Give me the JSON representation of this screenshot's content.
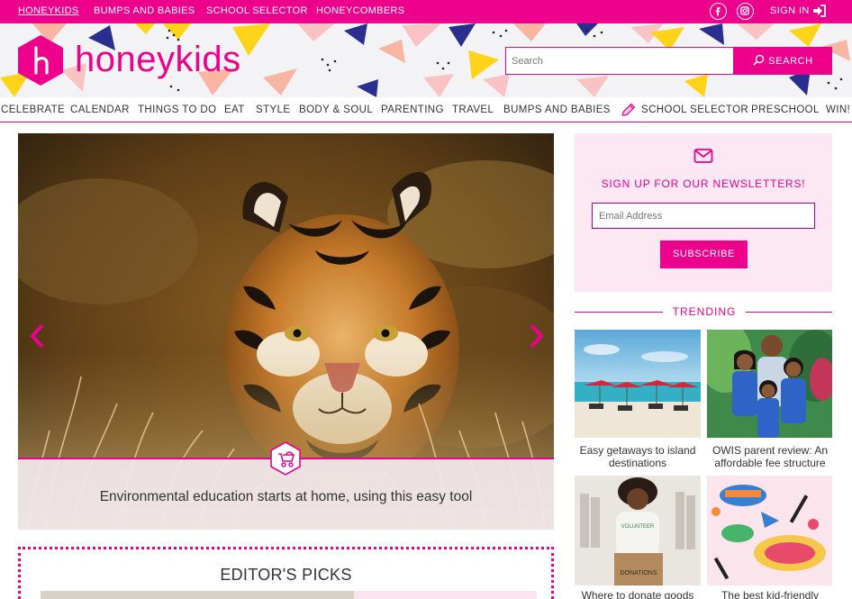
{
  "topbar": {
    "links": [
      "HONEYKIDS",
      "BUMPS AND BABIES",
      "SCHOOL SELECTOR",
      "HONEYCOMBERS"
    ],
    "signin_label": "SIGN IN"
  },
  "header": {
    "logo_letter": "h",
    "logo_text": "honeykids",
    "search_placeholder": "Search",
    "search_button": "SEARCH"
  },
  "nav": {
    "items": [
      "CELEBRATE",
      "CALENDAR",
      "THINGS TO DO",
      "EAT",
      "STYLE",
      "BODY & SOUL",
      "PARENTING",
      "TRAVEL",
      "BUMPS AND BABIES",
      "SCHOOL SELECTOR",
      "PRESCHOOL",
      "WIN!"
    ]
  },
  "hero": {
    "caption": "Environmental education starts at home, using this easy tool"
  },
  "editors_picks": {
    "title": "EDITOR'S PICKS"
  },
  "newsletter": {
    "title": "SIGN UP FOR OUR NEWSLETTERS!",
    "email_placeholder": "Email Address",
    "subscribe_label": "SUBSCRIBE"
  },
  "trending": {
    "title": "TRENDING",
    "items": [
      {
        "caption": "Easy getaways to island destinations"
      },
      {
        "caption": "OWIS parent review: An affordable fee structure"
      },
      {
        "caption": "Where to donate goods"
      },
      {
        "caption": "The best kid-friendly"
      }
    ]
  },
  "colors": {
    "brand": "#ec008c",
    "newsletter_bg": "#fde7f2",
    "header_bg": "#f3f3f6"
  },
  "icons": [
    "facebook-icon",
    "instagram-icon",
    "signin-icon",
    "search-icon",
    "pencil-icon",
    "mail-icon",
    "stroller-icon",
    "chevron-left-icon",
    "chevron-right-icon"
  ]
}
